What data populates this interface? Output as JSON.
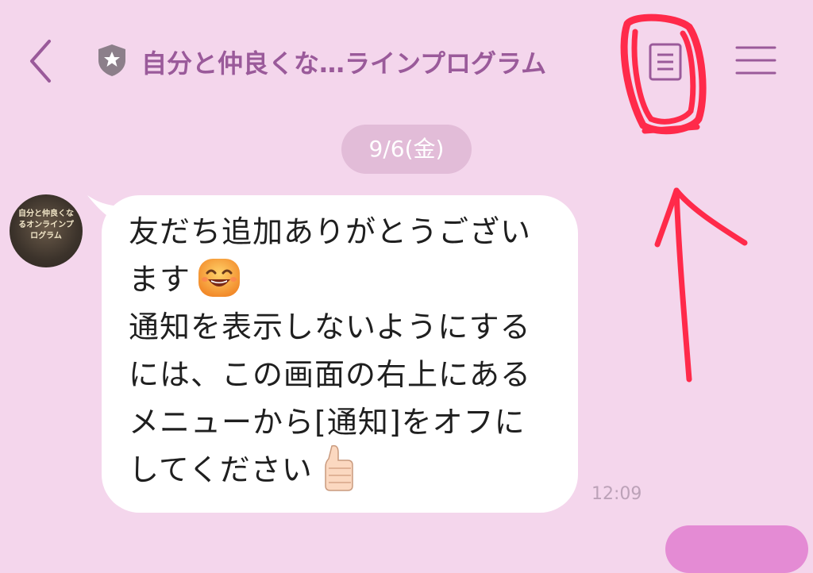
{
  "header": {
    "back_icon": "chevron-left-icon",
    "official_badge_icon": "shield-star-icon",
    "title": "自分と仲良くな…ラインプログラム",
    "note_icon": "note-icon",
    "menu_icon": "hamburger-menu-icon"
  },
  "chat": {
    "date_label": "9/6(金)",
    "avatar_caption": "自分と仲良くなるオンラインプログラム",
    "message": {
      "lines": [
        "友だち追加ありがとうござい",
        "ます",
        "通知を表示しないようにする",
        "には、この画面の右上にある",
        "メニューから[通知]をオフに",
        "してください"
      ],
      "emoji_1": "smiling-face-emoji",
      "emoji_2": "thumbs-up-emoji"
    },
    "timestamp": "12:09"
  },
  "colors": {
    "background": "#f4d6ec",
    "accent": "#9a5a9a",
    "bubble": "#ffffff",
    "annotation": "#ff2a4a"
  }
}
